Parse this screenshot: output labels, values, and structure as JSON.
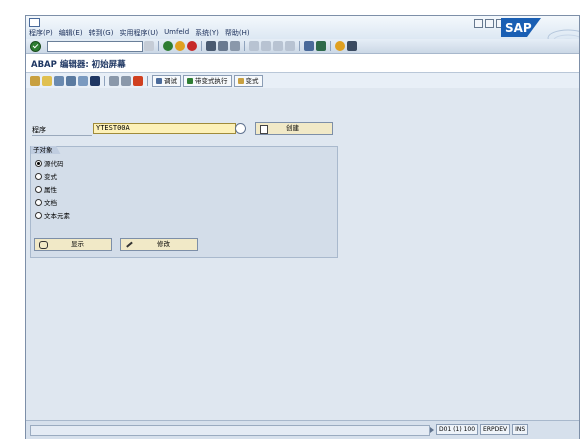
{
  "menu": [
    "程序(P)",
    "编辑(E)",
    "转到(G)",
    "实用程序(U)",
    "Umfeld",
    "系统(Y)",
    "帮助(H)"
  ],
  "sap_logo": "SAP",
  "command_field": {
    "value": ""
  },
  "screen_title": "ABAP 编辑器: 初始屏幕",
  "app_toolbar": {
    "debug_label": "调试",
    "variant_exec_label": "带变式执行",
    "variants_label": "变式"
  },
  "program": {
    "label": "程序",
    "value": "YTEST00A",
    "create_label": "创建"
  },
  "subobjects": {
    "title": "子对象",
    "options": [
      {
        "label": "源代码",
        "selected": true
      },
      {
        "label": "变式",
        "selected": false
      },
      {
        "label": "属性",
        "selected": false
      },
      {
        "label": "文档",
        "selected": false
      },
      {
        "label": "文本元素",
        "selected": false
      }
    ],
    "display_label": "显示",
    "change_label": "修改"
  },
  "status": {
    "system": "D01 (1) 100",
    "server": "ERPDEV",
    "mode": "INS"
  },
  "colors": {
    "accent": "#1f3763",
    "button_bg": "#f1e9c7",
    "input_required": "#fdf1b8",
    "ok_green": "#2e7d32"
  }
}
